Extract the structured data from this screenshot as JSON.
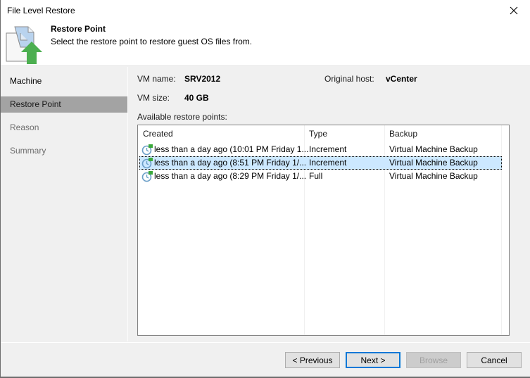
{
  "window": {
    "title": "File Level Restore",
    "close_icon": "close-icon"
  },
  "header": {
    "icon": "restore-file-icon",
    "title": "Restore Point",
    "subtitle": "Select the restore point to restore guest OS files from."
  },
  "sidebar": {
    "items": [
      {
        "label": "Machine",
        "state": "normal"
      },
      {
        "label": "Restore Point",
        "state": "active"
      },
      {
        "label": "Reason",
        "state": "disabled"
      },
      {
        "label": "Summary",
        "state": "disabled"
      }
    ]
  },
  "details": {
    "vm_name_label": "VM name:",
    "vm_name_value": "SRV2012",
    "host_label": "Original host:",
    "host_value": "vCenter",
    "vm_size_label": "VM size:",
    "vm_size_value": "40 GB",
    "list_label": "Available restore points:"
  },
  "restore_points": {
    "columns": [
      "Created",
      "Type",
      "Backup"
    ],
    "row_icon": "restore-point-clock-icon",
    "rows": [
      {
        "created": "less than a day ago (10:01 PM Friday 1...",
        "type": "Increment",
        "backup": "Virtual Machine Backup",
        "selected": false
      },
      {
        "created": "less than a day ago (8:51 PM Friday 1/...",
        "type": "Increment",
        "backup": "Virtual Machine Backup",
        "selected": true
      },
      {
        "created": "less than a day ago (8:29 PM Friday 1/...",
        "type": "Full",
        "backup": "Virtual Machine Backup",
        "selected": false
      }
    ]
  },
  "buttons": {
    "previous": "< Previous",
    "next": "Next >",
    "browse": "Browse",
    "cancel": "Cancel"
  },
  "colors": {
    "selection": "#cce8ff",
    "active_nav": "#a3a3a3",
    "default_button_border": "#0078d7",
    "arrow_green": "#4caf50"
  }
}
